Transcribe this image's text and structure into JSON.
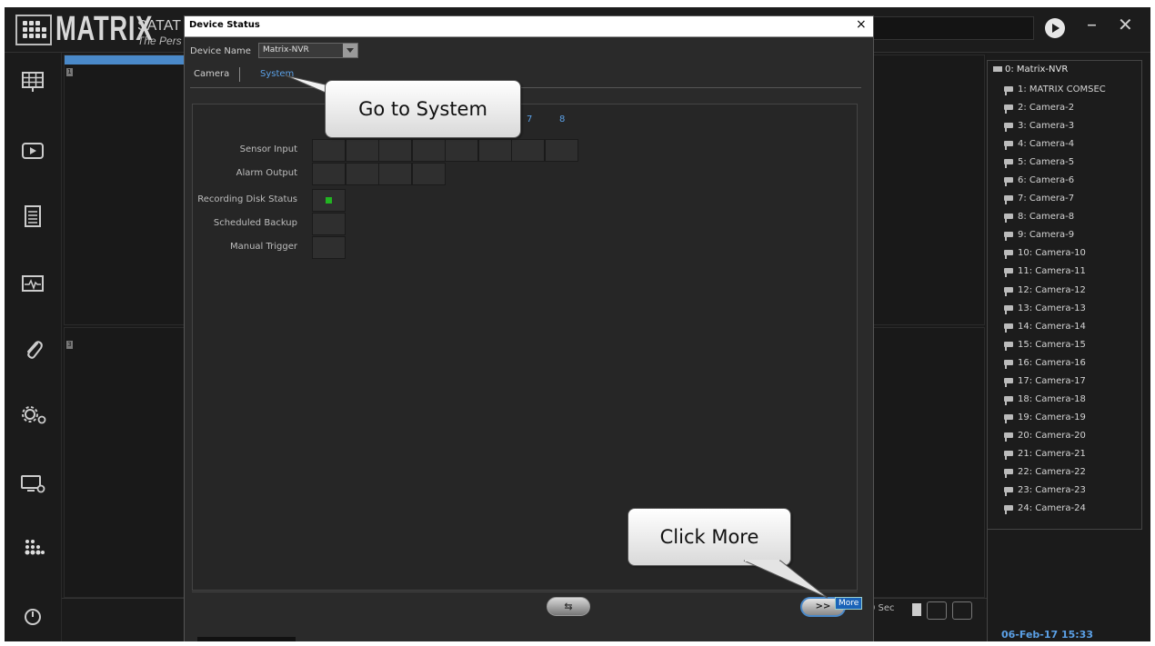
{
  "app": {
    "logo_text": "MATRIX",
    "title": "SATAT",
    "subtitle": "The Pers"
  },
  "sidebar": {
    "items": [
      {
        "icon": "live-view-grid-icon"
      },
      {
        "icon": "playback-icon"
      },
      {
        "icon": "event-log-icon"
      },
      {
        "icon": "health-monitor-icon"
      },
      {
        "icon": "attachment-icon"
      },
      {
        "icon": "settings-gears-icon"
      },
      {
        "icon": "display-settings-icon"
      },
      {
        "icon": "matrix-logo-icon"
      },
      {
        "icon": "power-icon"
      }
    ]
  },
  "grid": {
    "tiles": [
      "1",
      "3"
    ],
    "sequence_interval": "0 Sec"
  },
  "dialog": {
    "title": "Device Status",
    "close": "×",
    "device_name_label": "Device Name",
    "device_name_value": "Matrix-NVR",
    "tabs": [
      "Camera",
      "System"
    ],
    "active_tab": "System",
    "columns": [
      "7",
      "8"
    ],
    "rows": [
      {
        "label": "Sensor Input",
        "cells": 8
      },
      {
        "label": "Alarm Output",
        "cells": 4
      },
      {
        "label": "Recording Disk Status",
        "cells": 1,
        "status_color": "#22b422"
      },
      {
        "label": "Scheduled Backup",
        "cells": 1
      },
      {
        "label": "Manual Trigger",
        "cells": 1
      }
    ],
    "refresh_label": "⇆",
    "more_label": ">>",
    "more_tooltip": "More"
  },
  "callouts": {
    "system": "Go to System",
    "more": "Click More"
  },
  "device_tree": {
    "root": "0: Matrix-NVR",
    "items": [
      "1: MATRIX COMSEC",
      "2: Camera-2",
      "3: Camera-3",
      "4: Camera-4",
      "5: Camera-5",
      "6: Camera-6",
      "7: Camera-7",
      "8: Camera-8",
      "9: Camera-9",
      "10: Camera-10",
      "11: Camera-11",
      "12: Camera-12",
      "13: Camera-13",
      "14: Camera-14",
      "15: Camera-15",
      "16: Camera-16",
      "17: Camera-17",
      "18: Camera-18",
      "19: Camera-19",
      "20: Camera-20",
      "21: Camera-21",
      "22: Camera-22",
      "23: Camera-23",
      "24: Camera-24"
    ]
  },
  "datetime": "06-Feb-17 15:33",
  "colors": {
    "accent": "#4a89c9",
    "link_blue": "#5ba0e6",
    "status_green": "#22b422"
  }
}
